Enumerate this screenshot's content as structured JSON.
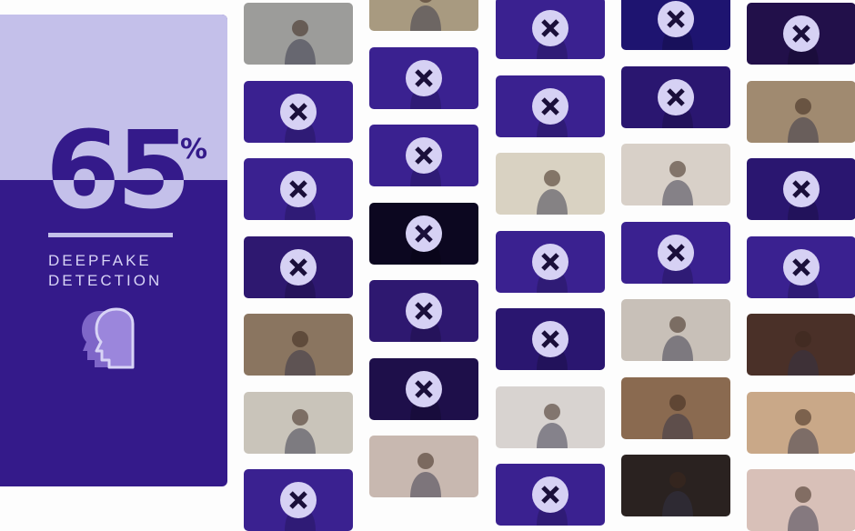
{
  "stat": {
    "value": "65",
    "unit": "%",
    "label_line1": "DEEPFAKE",
    "label_line2": "DETECTION"
  },
  "colors": {
    "panel_dark": "#341a8a",
    "panel_light": "#c4c0ea",
    "fake_tint": "#3a2190"
  },
  "tiles": [
    [
      "real:#9c9c9a",
      "fake:#3a2190",
      "fake:#3a2190",
      "fake:#2e1870",
      "real:#8a7560",
      "real:#c9c4ba",
      "fake:#3a2190"
    ],
    [
      "real:#a89a80",
      "fake:#3a2190",
      "fake:#3a2190",
      "fake:#0c0720",
      "fake:#2e1870",
      "fake:#1e0f4a",
      "real:#c8b8b0"
    ],
    [
      "fake:#3a2190",
      "fake:#3a2190",
      "real:#d9d2c2",
      "fake:#3a2190",
      "fake:#2a1670",
      "real:#d8d3d0",
      "fake:#3a2190"
    ],
    [
      "fake:#1e1470",
      "fake:#2a1670",
      "real:#d8d0c8",
      "fake:#3a2190",
      "real:#c8c0b8",
      "real:#8a6a50",
      "real:#2a2220"
    ],
    [
      "fake:#22104a",
      "real:#a08a70",
      "fake:#2a1670",
      "fake:#3a2190",
      "real:#4a3028",
      "real:#c9a888",
      "real:#d8c0b8"
    ]
  ]
}
